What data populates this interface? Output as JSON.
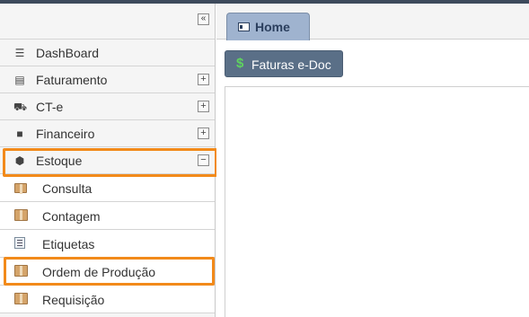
{
  "sidebar": {
    "collapse_glyph": "«",
    "menu": [
      {
        "label": "DashBoard",
        "icon": "list-icon",
        "toggle": ""
      },
      {
        "label": "Faturamento",
        "icon": "document-icon",
        "toggle": "+"
      },
      {
        "label": "CT-e",
        "icon": "truck-icon",
        "toggle": "+"
      },
      {
        "label": "Financeiro",
        "icon": "briefcase-icon",
        "toggle": "+"
      },
      {
        "label": "Estoque",
        "icon": "cube-icon",
        "toggle": "−"
      }
    ],
    "submenu": [
      {
        "label": "Consulta",
        "icon": "box-search-icon"
      },
      {
        "label": "Contagem",
        "icon": "box-icon"
      },
      {
        "label": "Etiquetas",
        "icon": "labels-icon"
      },
      {
        "label": "Ordem de Produção",
        "icon": "box-icon"
      },
      {
        "label": "Requisição",
        "icon": "box-icon"
      }
    ]
  },
  "tabs": [
    {
      "label": "Home",
      "icon": "window-icon"
    }
  ],
  "toolbar": {
    "button_label": "Faturas e-Doc",
    "button_icon": "$"
  },
  "colors": {
    "highlight": "#f28a1a",
    "tab": "#9fb3cf",
    "button": "#5a6f87",
    "dollar": "#5fd35f"
  }
}
